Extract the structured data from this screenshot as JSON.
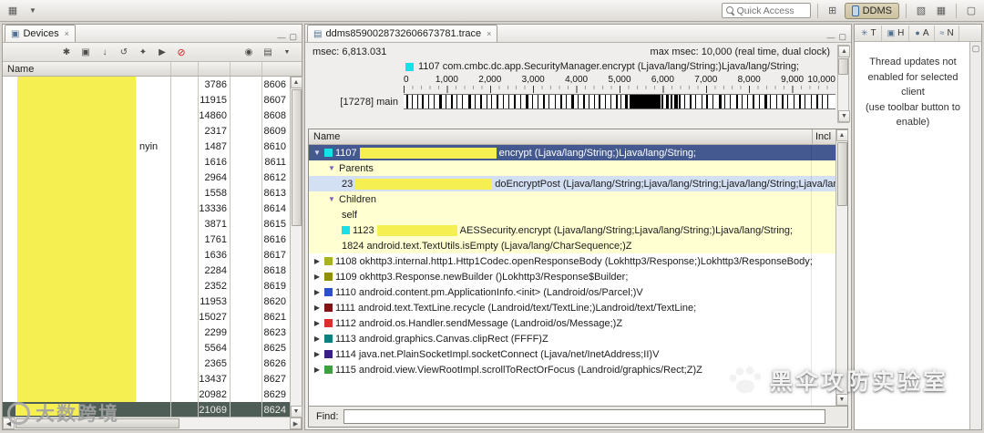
{
  "topbar": {
    "quick_access": "Quick Access",
    "ddms_label": "DDMS"
  },
  "icons": {
    "close": "×",
    "minimize": "—",
    "maximize": "▢",
    "devices_tab": "▣",
    "trace_tab": "▤",
    "debug": "✱",
    "update_heap": "▣",
    "dump_hprof": "↓",
    "gc": "↺",
    "update_threads": "✦",
    "start_profiling": "▶",
    "stop_process": "⊘",
    "screen_capture": "◉",
    "view_menu": "▤",
    "dropdown": "▼",
    "scroll_up": "▲",
    "scroll_down": "▼",
    "scroll_left": "◀",
    "scroll_right": "▶",
    "open_perspective": "⊞",
    "perspective_a": "▦",
    "perspective_b": "▧",
    "threads_view": "✳",
    "heap_view": "▣",
    "alloc_view": "●",
    "network_view": "≈",
    "restore_view": "▢",
    "tree_expanded": "▼",
    "tree_collapsed": "▶"
  },
  "devices": {
    "tab": "Devices",
    "name_header": "Name",
    "rows": [
      {
        "n1": "3786",
        "n2": "8606"
      },
      {
        "n1": "11915",
        "n2": "8607"
      },
      {
        "n1": "14860",
        "n2": "8608"
      },
      {
        "n1": "2317",
        "n2": "8609"
      },
      {
        "frag": "nyin",
        "n1": "1487",
        "n2": "8610"
      },
      {
        "n1": "1616",
        "n2": "8611"
      },
      {
        "n1": "2964",
        "n2": "8612"
      },
      {
        "n1": "1558",
        "n2": "8613"
      },
      {
        "n1": "13336",
        "n2": "8614"
      },
      {
        "n1": "3871",
        "n2": "8615"
      },
      {
        "n1": "1761",
        "n2": "8616"
      },
      {
        "n1": "1636",
        "n2": "8617"
      },
      {
        "n1": "2284",
        "n2": "8618"
      },
      {
        "n1": "2352",
        "n2": "8619"
      },
      {
        "n1": "11953",
        "n2": "8620"
      },
      {
        "n1": "15027",
        "n2": "8621"
      },
      {
        "n1": "2299",
        "n2": "8623"
      },
      {
        "n1": "5564",
        "n2": "8625"
      },
      {
        "n1": "2365",
        "n2": "8626"
      },
      {
        "n1": "13437",
        "n2": "8627"
      },
      {
        "n1": "20982",
        "n2": "8629"
      },
      {
        "sel": true,
        "n1": "21069",
        "n2": "8624"
      }
    ]
  },
  "trace": {
    "tab": "ddms8590028732606673781.trace",
    "msec": "msec: 6,813.031",
    "max_msec": "max msec: 10,000 (real time, dual clock)",
    "legend": "1107 com.cmbc.dc.app.SecurityManager.encrypt (Ljava/lang/String;)Ljava/lang/String;",
    "legend_color": "#19dfe6",
    "axis": [
      "0",
      "1,000",
      "2,000",
      "3,000",
      "4,000",
      "5,000",
      "6,000",
      "7,000",
      "8,000",
      "9,000",
      "10,000"
    ],
    "thread": "[17278] main",
    "marks": [
      [
        0.6,
        2
      ],
      [
        1.8,
        1
      ],
      [
        3.1,
        1
      ],
      [
        4.3,
        2
      ],
      [
        5.6,
        1
      ],
      [
        7.0,
        1
      ],
      [
        8.2,
        3
      ],
      [
        9.6,
        1
      ],
      [
        11.0,
        2
      ],
      [
        12.3,
        1
      ],
      [
        13.6,
        1
      ],
      [
        15.0,
        3
      ],
      [
        16.4,
        1
      ],
      [
        17.8,
        2
      ],
      [
        19.1,
        1
      ],
      [
        20.3,
        1
      ],
      [
        21.6,
        2
      ],
      [
        23.0,
        1
      ],
      [
        24.2,
        1
      ],
      [
        25.6,
        2
      ],
      [
        27.0,
        1
      ],
      [
        28.3,
        3
      ],
      [
        29.7,
        1
      ],
      [
        31.0,
        1
      ],
      [
        32.2,
        2
      ],
      [
        33.6,
        1
      ],
      [
        35.0,
        1
      ],
      [
        36.2,
        2
      ],
      [
        37.6,
        1
      ],
      [
        38.9,
        3
      ],
      [
        40.2,
        1
      ],
      [
        41.5,
        2
      ],
      [
        42.8,
        1
      ],
      [
        44.0,
        1
      ],
      [
        45.2,
        2
      ],
      [
        46.6,
        1
      ],
      [
        47.9,
        1
      ],
      [
        49.1,
        2
      ],
      [
        50.3,
        1
      ],
      [
        51.3,
        3
      ],
      [
        52.3,
        6
      ],
      [
        53.5,
        9
      ],
      [
        55.1,
        12
      ],
      [
        57.1,
        7
      ],
      [
        58.7,
        4
      ],
      [
        59.8,
        2
      ],
      [
        60.7,
        3
      ],
      [
        61.8,
        2
      ],
      [
        62.7,
        4
      ],
      [
        63.8,
        2
      ],
      [
        65.0,
        1
      ],
      [
        66.2,
        2
      ],
      [
        67.5,
        1
      ],
      [
        68.9,
        1
      ],
      [
        70.1,
        2
      ],
      [
        71.5,
        1
      ],
      [
        72.9,
        3
      ],
      [
        74.3,
        1
      ],
      [
        75.5,
        1
      ],
      [
        76.9,
        2
      ],
      [
        78.3,
        1
      ],
      [
        79.5,
        1
      ],
      [
        80.9,
        2
      ],
      [
        82.3,
        1
      ],
      [
        83.5,
        3
      ],
      [
        84.9,
        1
      ],
      [
        86.3,
        1
      ],
      [
        87.5,
        2
      ],
      [
        88.9,
        1
      ],
      [
        90.3,
        1
      ],
      [
        91.5,
        2
      ],
      [
        92.9,
        1
      ],
      [
        94.3,
        1
      ],
      [
        95.5,
        2
      ],
      [
        96.9,
        1
      ],
      [
        98.1,
        1
      ]
    ],
    "table": {
      "name_header": "Name",
      "incl_header": "Incl",
      "rows": [
        {
          "bg": "sel",
          "arrow": "down",
          "arrowColor": "#d9d9ef",
          "swatch": "#19dfe6",
          "num": "1107",
          "redactW": 150,
          "text": "encrypt (Ljava/lang/String;)Ljava/lang/String;",
          "indent": 4
        },
        {
          "bg": "#ffffd2",
          "indent": 20,
          "arrow": "down",
          "arrowColor": "#7d5fb2",
          "text": "Parents"
        },
        {
          "bg": "#d3dff3",
          "indent": 36,
          "num": "23",
          "redactW": 150,
          "text": "doEncryptPost (Ljava/lang/String;Ljava/lang/String;Ljava/lang/String;Ljava/lang/String;)Lcom/cmbc/firefly/netw"
        },
        {
          "bg": "#ffffd2",
          "indent": 20,
          "arrow": "down",
          "arrowColor": "#7d5fb2",
          "text": "Children"
        },
        {
          "bg": "#ffffd2",
          "indent": 36,
          "text": "self"
        },
        {
          "bg": "#ffffd2",
          "indent": 36,
          "swatch": "#19dfe6",
          "num": "1123",
          "redactW": 88,
          "text": "AESSecurity.encrypt (Ljava/lang/String;Ljava/lang/String;)Ljava/lang/String;"
        },
        {
          "bg": "#ffffd2",
          "indent": 36,
          "num": "1824",
          "text": "android.text.TextUtils.isEmpty (Ljava/lang/CharSequence;)Z"
        },
        {
          "bg": "#ffffff",
          "indent": 4,
          "arrow": "right",
          "arrowColor": "#3a3a3a",
          "swatch": "#a9b31f",
          "num": "1108",
          "text": "okhttp3.internal.http1.Http1Codec.openResponseBody (Lokhttp3/Response;)Lokhttp3/ResponseBody;"
        },
        {
          "bg": "#ffffff",
          "indent": 4,
          "arrow": "right",
          "arrowColor": "#3a3a3a",
          "swatch": "#8f8f00",
          "num": "1109",
          "text": "okhttp3.Response.newBuilder ()Lokhttp3/Response$Builder;"
        },
        {
          "bg": "#ffffff",
          "indent": 4,
          "arrow": "right",
          "arrowColor": "#3a3a3a",
          "swatch": "#2c50c8",
          "num": "1110",
          "text": "android.content.pm.ApplicationInfo.<init> (Landroid/os/Parcel;)V"
        },
        {
          "bg": "#ffffff",
          "indent": 4,
          "arrow": "right",
          "arrowColor": "#3a3a3a",
          "swatch": "#7e1414",
          "num": "1111",
          "text": "android.text.TextLine.recycle (Landroid/text/TextLine;)Landroid/text/TextLine;"
        },
        {
          "bg": "#ffffff",
          "indent": 4,
          "arrow": "right",
          "arrowColor": "#3a3a3a",
          "swatch": "#de2d2d",
          "num": "1112",
          "text": "android.os.Handler.sendMessage (Landroid/os/Message;)Z"
        },
        {
          "bg": "#ffffff",
          "indent": 4,
          "arrow": "right",
          "arrowColor": "#3a3a3a",
          "swatch": "#0f7f7f",
          "num": "1113",
          "text": "android.graphics.Canvas.clipRect (FFFF)Z"
        },
        {
          "bg": "#ffffff",
          "indent": 4,
          "arrow": "right",
          "arrowColor": "#3a3a3a",
          "swatch": "#3a2080",
          "num": "1114",
          "text": "java.net.PlainSocketImpl.socketConnect (Ljava/net/InetAddress;II)V"
        },
        {
          "bg": "#ffffff",
          "indent": 4,
          "arrow": "right",
          "arrowColor": "#3a3a3a",
          "swatch": "#3f9f3f",
          "num": "1115",
          "text": "android.view.ViewRootImpl.scrollToRectOrFocus (Landroid/graphics/Rect;Z)Z"
        }
      ]
    },
    "find_label": "Find:"
  },
  "right_panel": {
    "views": [
      "T",
      "H",
      "A",
      "N"
    ],
    "message_line1": "Thread updates not enabled for selected client",
    "message_line2": "(use toolbar button to enable)"
  },
  "watermarks": {
    "bottom_right": "黑伞攻防实验室",
    "bottom_left": "大数跨境"
  }
}
